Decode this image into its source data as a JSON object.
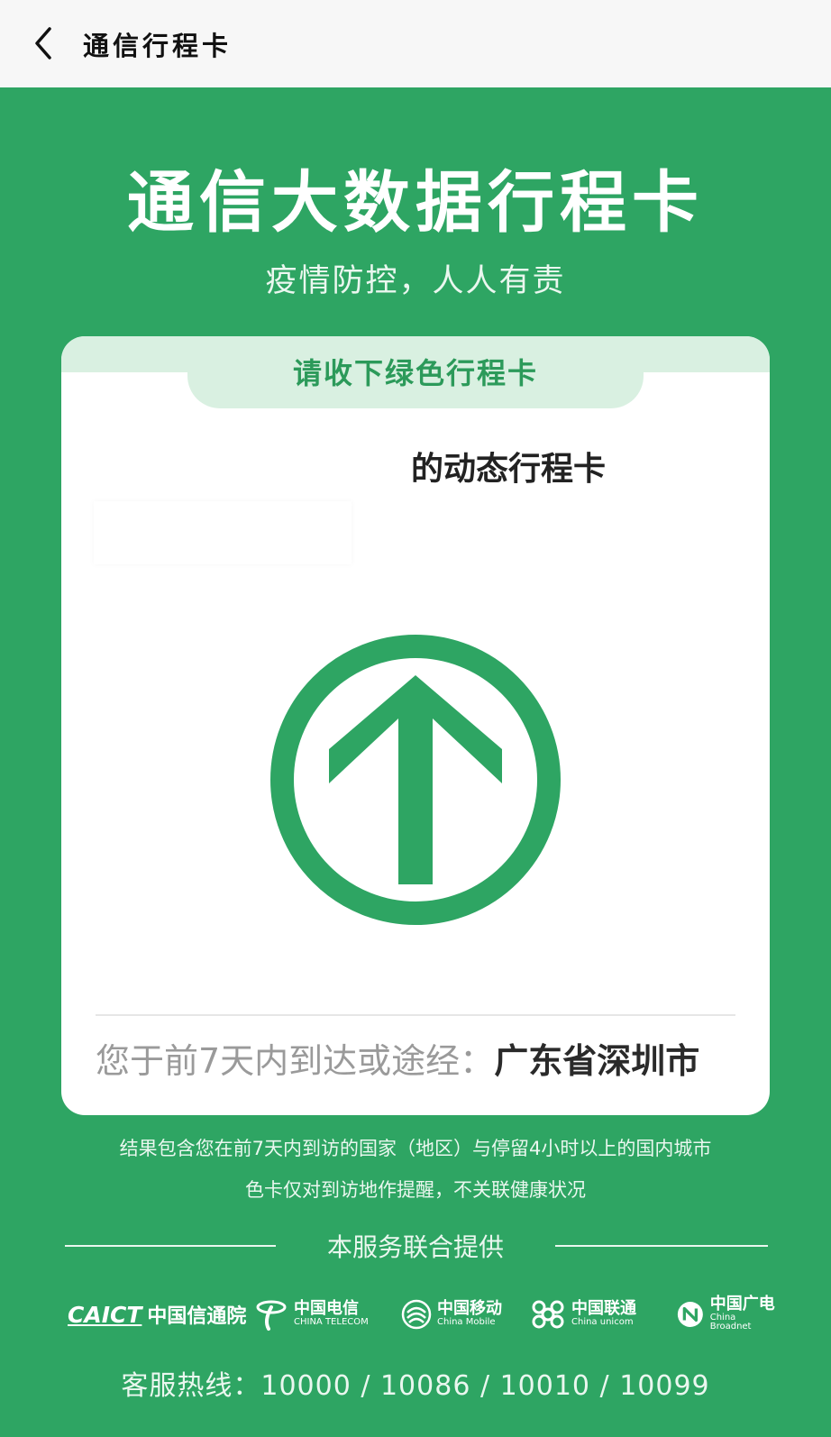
{
  "header": {
    "title": "通信行程卡"
  },
  "banner": {
    "title": "通信大数据行程卡",
    "subtitle": "疫情防控，人人有责"
  },
  "card": {
    "tab_label": "请收下绿色行程卡",
    "dynamic_label": "的动态行程卡",
    "status_color": "#2ea563",
    "icon": "green-arrow-up-icon",
    "visited_prefix": "您于前7天内到达或途经：",
    "visited_city": "广东省深圳市"
  },
  "notes": {
    "line1": "结果包含您在前7天内到访的国家（地区）与停留4小时以上的国内城市",
    "line2": "色卡仅对到访地作提醒，不关联健康状况"
  },
  "providers": {
    "label": "本服务联合提供",
    "items": [
      {
        "mark": "CAICT",
        "name": "中国信通院"
      },
      {
        "name": "中国电信",
        "en": "CHINA TELECOM"
      },
      {
        "name": "中国移动",
        "en": "China Mobile"
      },
      {
        "name": "中国联通",
        "en": "China unicom"
      },
      {
        "name": "中国广电",
        "en": "China Broadnet"
      }
    ]
  },
  "hotline": {
    "text": "客服热线：10000 / 10086 / 10010 / 10099"
  }
}
